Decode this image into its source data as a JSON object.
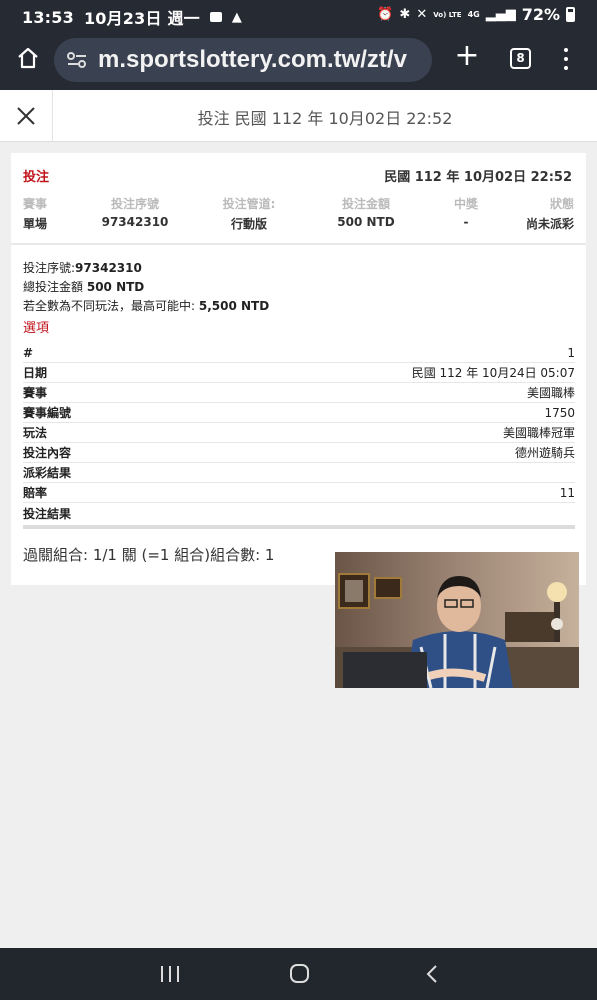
{
  "status_bar": {
    "time": "13:53",
    "date": "10月23日 週一",
    "battery": "72%",
    "icons": [
      "message-icon",
      "warning-icon",
      "alarm-icon",
      "bluetooth-icon",
      "mute-icon",
      "volte-icon",
      "4g-icon",
      "signal-icon",
      "battery-icon"
    ],
    "volte_label": "Vo) LTE",
    "net_label": "4G"
  },
  "browser": {
    "url": "m.sportslottery.com.tw/zt/v",
    "tab_count": "8"
  },
  "header": {
    "title": "投注 民國 112 年 10月02日 22:52"
  },
  "summary": {
    "type_label": "投注",
    "date": "民國 112 年 10月02日 22:52",
    "headers": [
      "賽事",
      "投注序號",
      "投注管道:",
      "投注金額",
      "中獎",
      "狀態"
    ],
    "values": [
      "單場",
      "97342310",
      "行動版",
      "500 NTD",
      "-",
      "尚未派彩"
    ]
  },
  "details": {
    "serial_label": "投注序號:",
    "serial": "97342310",
    "amount_label": "總投注金額",
    "amount": "500 NTD",
    "max_label": "若全數為不同玩法，最高可能中:",
    "max_value": "5,500 NTD",
    "options_title": "選項",
    "rows": [
      {
        "label": "#",
        "value": "1"
      },
      {
        "label": "日期",
        "value": "民國 112 年 10月24日 05:07"
      },
      {
        "label": "賽事",
        "value": "美國職棒"
      },
      {
        "label": "賽事編號",
        "value": "1750"
      },
      {
        "label": "玩法",
        "value": "美國職棒冠軍"
      },
      {
        "label": "投注內容",
        "value": "德州遊騎兵"
      },
      {
        "label": "派彩結果",
        "value": ""
      },
      {
        "label": "賠率",
        "value": "11"
      },
      {
        "label": "投注結果",
        "value": ""
      }
    ],
    "combo_text": "過關組合: 1/1 關 (=1 組合)組合數: 1"
  },
  "colors": {
    "accent_red": "#c0141b",
    "chrome_dark": "#262a32",
    "url_bg": "#3a4150"
  }
}
